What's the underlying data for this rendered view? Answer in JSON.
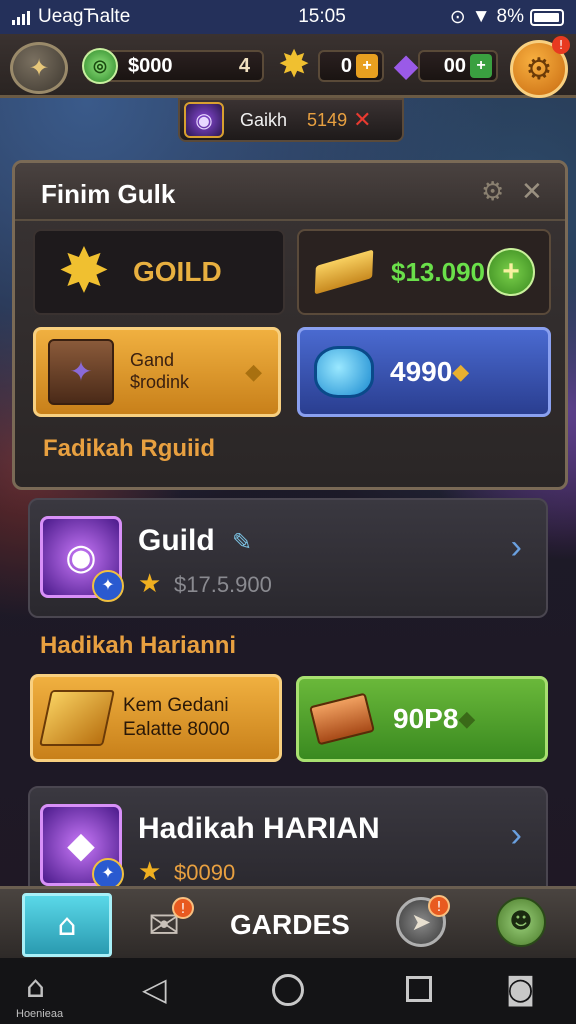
{
  "status_bar": {
    "carrier": "UeagЋalte",
    "time": "15:05",
    "battery": "8%",
    "signal_icon": "signal-bars-icon",
    "wifi_icon": "wifi-icon"
  },
  "hud": {
    "cash_value": "$000",
    "cash_add": "4",
    "gold_value": "0",
    "gold_add": "+",
    "gem_value": "00",
    "gem_add": "+",
    "settings_badge": "!"
  },
  "notice": {
    "label": "Gaikh",
    "value": "5149",
    "close": "✕"
  },
  "panel": {
    "title": "Finim Gulk",
    "gold_label": "GOILD",
    "bar_value": "$13.090",
    "bar_plus": "+",
    "chest_line1": "Gand",
    "chest_line2": "$rodink",
    "blue_value": "4990",
    "subtitle": "Fadikah Rguiid"
  },
  "cards": [
    {
      "title": "Guild",
      "value": "$17.5.900",
      "chevron": "›"
    },
    {
      "title": "Hadikah HARIAN",
      "value": "$0090",
      "chevron": "›"
    }
  ],
  "section2": {
    "title": "Hadikah Harianni",
    "scroll_line1": "Kem Gedani",
    "scroll_line2": "Ealatte 8000",
    "green_value": "90P8"
  },
  "nav": {
    "label": "GARDES",
    "mail_badge": "!",
    "compass_badge": "!"
  },
  "android": {
    "home_label": "Hoenieaa"
  },
  "colors": {
    "accent_orange": "#e8a040",
    "accent_green": "#6ae04a",
    "accent_blue": "#4a6ad0",
    "panel_bg": "#3a3434"
  }
}
